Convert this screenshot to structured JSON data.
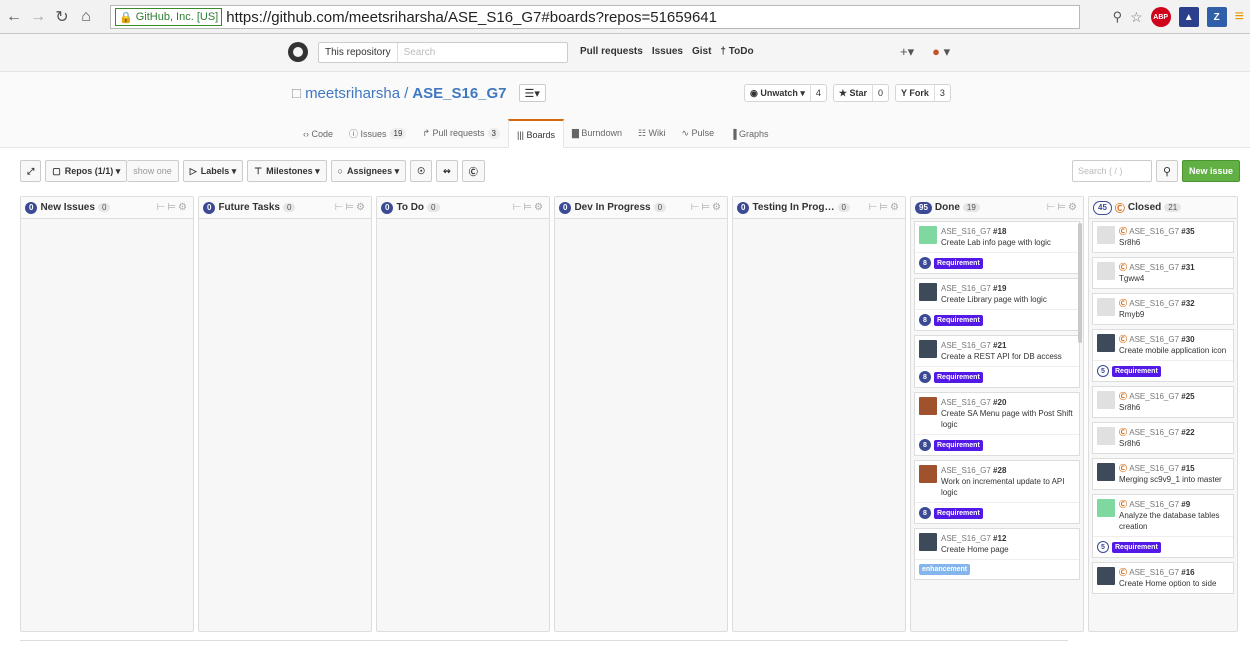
{
  "browser": {
    "ssl_label": "GitHub, Inc. [US]",
    "url": "https://github.com/meetsriharsha/ASE_S16_G7#boards?repos=51659641",
    "ext_abp": "ABP",
    "ext_z": "Z"
  },
  "header": {
    "search_scope": "This repository",
    "search_placeholder": "Search",
    "nav": [
      "Pull requests",
      "Issues",
      "Gist",
      "† ToDo"
    ],
    "plus": "+▾"
  },
  "repo": {
    "owner": "meetsriharsha",
    "sep": "/",
    "name": "ASE_S16_G7",
    "menu": "☰▾",
    "unwatch": "◉ Unwatch ▾",
    "watch_count": "4",
    "star": "★ Star",
    "star_count": "0",
    "fork": "Y Fork",
    "fork_count": "3",
    "tabs": [
      {
        "label": "‹› Code",
        "count": ""
      },
      {
        "label": "ⓘ Issues",
        "count": "19"
      },
      {
        "label": "↱ Pull requests",
        "count": "3"
      },
      {
        "label": "||| Boards",
        "count": ""
      },
      {
        "label": "▇ Burndown",
        "count": ""
      },
      {
        "label": "☷ Wiki",
        "count": ""
      },
      {
        "label": "∿ Pulse",
        "count": ""
      },
      {
        "label": "▐ Graphs",
        "count": ""
      }
    ]
  },
  "toolbar": {
    "expand": "⤢",
    "repos": "Repos (1/1) ▾",
    "show_one": "show one",
    "labels": "Labels ▾",
    "milestones": "Milestones ▾",
    "assignees": "Assignees ▾",
    "search_placeholder": "Search ( / )",
    "new_issue": "New issue"
  },
  "columns": [
    {
      "title": "New Issues",
      "est": "0",
      "count": "0"
    },
    {
      "title": "Future Tasks",
      "est": "0",
      "count": "0"
    },
    {
      "title": "To Do",
      "est": "0",
      "count": "0"
    },
    {
      "title": "Dev In Progress",
      "est": "0",
      "count": "0"
    },
    {
      "title": "Testing In Prog…",
      "est": "0",
      "count": "0"
    }
  ],
  "done": {
    "title": "Done",
    "est": "95",
    "count": "19",
    "cards": [
      {
        "ref": "ASE_S16_G7",
        "num": "#18",
        "title": "Create Lab info page with logic",
        "est": "8",
        "label": "Requirement",
        "avatar": "#7fd8a0"
      },
      {
        "ref": "ASE_S16_G7",
        "num": "#19",
        "title": "Create Library page with logic",
        "est": "8",
        "label": "Requirement",
        "avatar": "#3d4a5a"
      },
      {
        "ref": "ASE_S16_G7",
        "num": "#21",
        "title": "Create a REST API for DB access",
        "est": "8",
        "label": "Requirement",
        "avatar": "#3d4a5a"
      },
      {
        "ref": "ASE_S16_G7",
        "num": "#20",
        "title": "Create SA Menu page with Post Shift logic",
        "est": "8",
        "label": "Requirement",
        "avatar": "#a0522d"
      },
      {
        "ref": "ASE_S16_G7",
        "num": "#28",
        "title": "Work on incremental update to API logic",
        "est": "8",
        "label": "Requirement",
        "avatar": "#a0522d"
      },
      {
        "ref": "ASE_S16_G7",
        "num": "#12",
        "title": "Create Home page",
        "est": "",
        "label": "enhancement",
        "avatar": "#3d4a5a"
      }
    ]
  },
  "closed": {
    "title": "Closed",
    "est": "45",
    "count": "21",
    "cards": [
      {
        "ref": "ASE_S16_G7",
        "num": "#35",
        "title": "Sr8h6",
        "est": "",
        "label": "",
        "avatar": "#e0e0e0"
      },
      {
        "ref": "ASE_S16_G7",
        "num": "#31",
        "title": "Tgww4",
        "est": "",
        "label": "",
        "avatar": "#e0e0e0"
      },
      {
        "ref": "ASE_S16_G7",
        "num": "#32",
        "title": "Rmyb9",
        "est": "",
        "label": "",
        "avatar": "#e0e0e0"
      },
      {
        "ref": "ASE_S16_G7",
        "num": "#30",
        "title": "Create mobile application icon",
        "est": "5",
        "label": "Requirement",
        "avatar": "#3d4a5a"
      },
      {
        "ref": "ASE_S16_G7",
        "num": "#25",
        "title": "Sr8h6",
        "est": "",
        "label": "",
        "avatar": "#e0e0e0"
      },
      {
        "ref": "ASE_S16_G7",
        "num": "#22",
        "title": "Sr8h6",
        "est": "",
        "label": "",
        "avatar": "#e0e0e0"
      },
      {
        "ref": "ASE_S16_G7",
        "num": "#15",
        "title": "Merging sc9v9_1 into master",
        "est": "",
        "label": "",
        "avatar": "#3d4a5a"
      },
      {
        "ref": "ASE_S16_G7",
        "num": "#9",
        "title": "Analyze the database tables creation",
        "est": "5",
        "label": "Requirement",
        "avatar": "#7fd8a0"
      },
      {
        "ref": "ASE_S16_G7",
        "num": "#16",
        "title": "Create Home option to side",
        "est": "",
        "label": "",
        "avatar": "#3d4a5a"
      }
    ]
  }
}
